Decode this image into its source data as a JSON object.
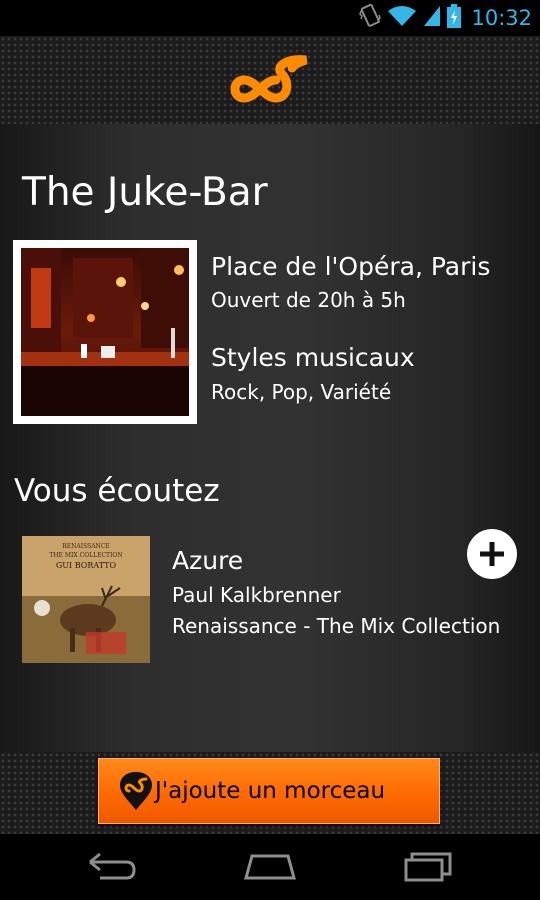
{
  "status_bar": {
    "time": "10:32",
    "icons": [
      "vibrate-icon",
      "wifi-icon",
      "signal-icon",
      "battery-charging-icon"
    ]
  },
  "header": {
    "logo": "juke-logo-icon"
  },
  "venue": {
    "name": "The Juke-Bar",
    "location": "Place de l'Opéra, Paris",
    "hours": "Ouvert de 20h à 5h",
    "styles_heading": "Styles musicaux",
    "styles": "Rock, Pop, Variété"
  },
  "now_playing": {
    "heading": "Vous écoutez",
    "title": "Azure",
    "artist": "Paul Kalkbrenner",
    "album": "Renaissance - The Mix Collection",
    "cover_text": [
      "RENAISSANCE",
      "THE MIX COLLECTION",
      "GUI BORATTO"
    ]
  },
  "cta": {
    "label": "J'ajoute un morceau"
  },
  "nav": {
    "icons": [
      "back-icon",
      "home-icon",
      "recent-apps-icon"
    ]
  },
  "colors": {
    "accent": "#ff7a00",
    "clock": "#33b5e5"
  }
}
